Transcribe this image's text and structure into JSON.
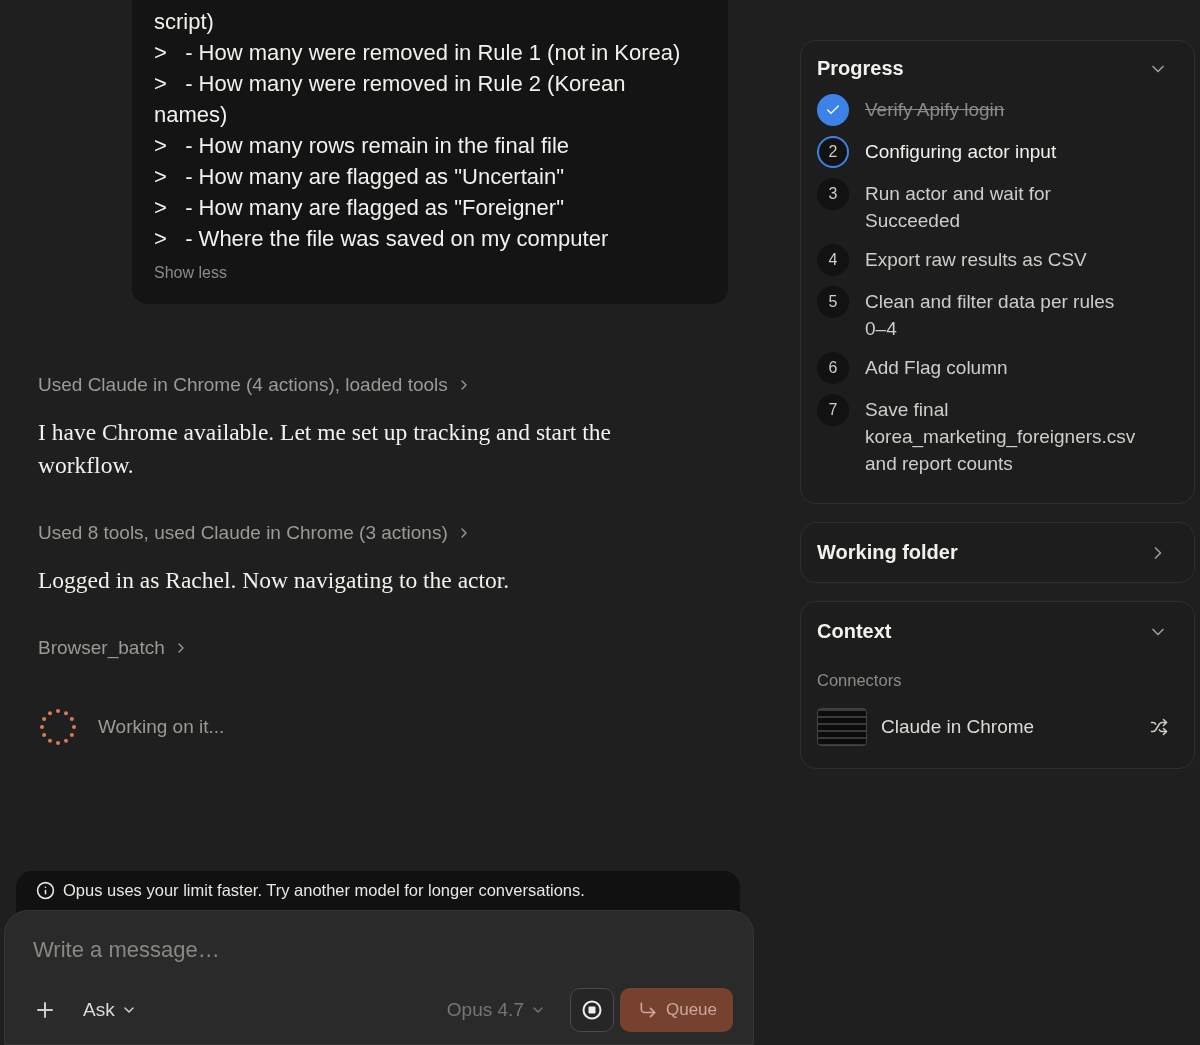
{
  "message": {
    "lines": [
      "script)",
      ">   - How many were removed in Rule 1 (not in Korea)",
      ">   - How many were removed in Rule 2 (Korean names)",
      ">   - How many rows remain in the final file",
      ">   - How many are flagged as \"Uncertain\"",
      ">   - How many are flagged as \"Foreigner\"",
      ">   - Where the file was saved on my computer"
    ],
    "toggle": "Show less"
  },
  "transcript": [
    {
      "kind": "tool",
      "text": "Used Claude in Chrome (4 actions), loaded tools"
    },
    {
      "kind": "reply",
      "text": "I have Chrome available. Let me set up tracking and start the workflow."
    },
    {
      "kind": "tool",
      "text": "Used 8 tools, used Claude in Chrome (3 actions)"
    },
    {
      "kind": "reply",
      "text": "Logged in as Rachel. Now navigating to the actor."
    },
    {
      "kind": "tool",
      "text": "Browser_batch"
    }
  ],
  "status": "Working on it...",
  "notice": "Opus uses your limit faster. Try another model for longer conversations.",
  "composer": {
    "placeholder": "Write a message…",
    "mode": "Ask",
    "model": "Opus 4.7",
    "send": "Queue"
  },
  "progress": {
    "title": "Progress",
    "expanded": true,
    "steps": [
      {
        "label": "Verify Apify login",
        "done": true,
        "current": false
      },
      {
        "number": "2",
        "label": "Configuring actor input",
        "done": false,
        "current": true
      },
      {
        "number": "3",
        "label": "Run actor and wait for Succeeded",
        "done": false,
        "current": false
      },
      {
        "number": "4",
        "label": "Export raw results as CSV",
        "done": false,
        "current": false
      },
      {
        "number": "5",
        "label": "Clean and filter data per rules 0–4",
        "done": false,
        "current": false
      },
      {
        "number": "6",
        "label": "Add Flag column",
        "done": false,
        "current": false
      },
      {
        "number": "7",
        "label": "Save final korea_marketing_foreigners.csv and report counts",
        "done": false,
        "current": false
      }
    ]
  },
  "working_folder": {
    "title": "Working folder",
    "expanded": false
  },
  "context": {
    "title": "Context",
    "expanded": true,
    "section": "Connectors",
    "connectors": [
      {
        "name": "Claude in Chrome"
      }
    ]
  }
}
